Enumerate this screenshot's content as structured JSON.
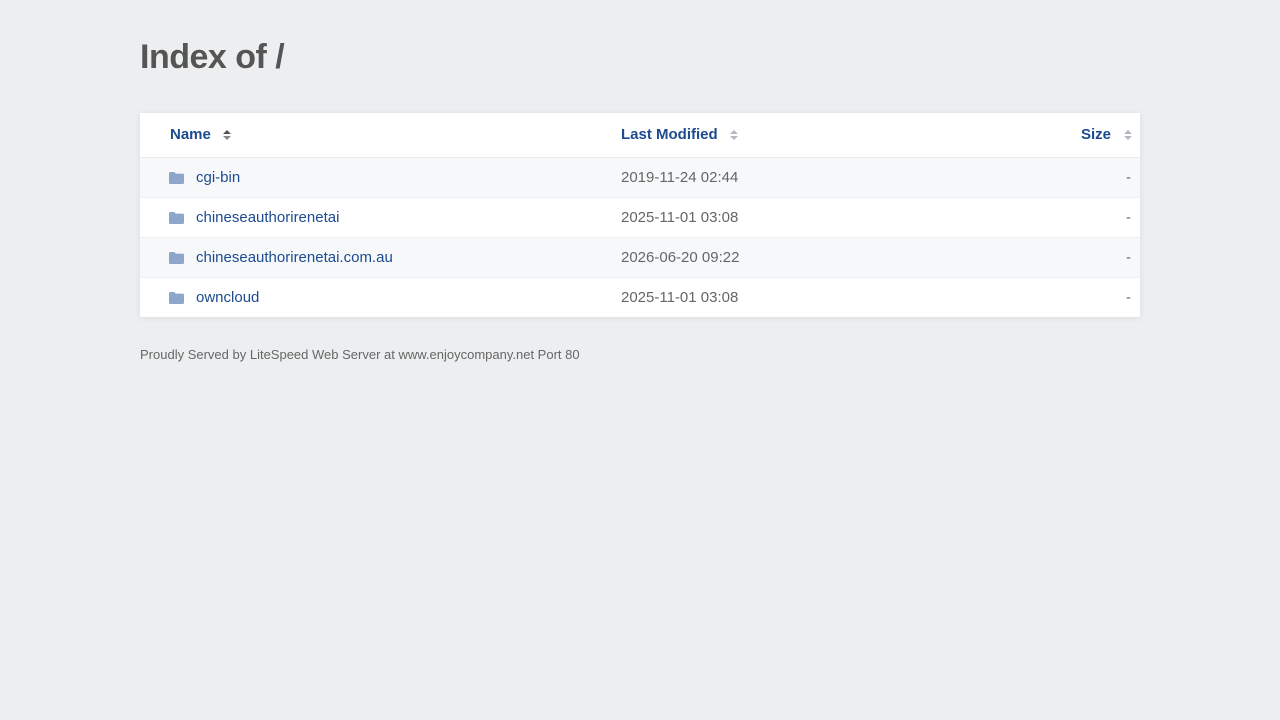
{
  "page": {
    "title": "Index of /"
  },
  "table": {
    "headers": {
      "name": "Name",
      "modified": "Last Modified",
      "size": "Size"
    },
    "rows": [
      {
        "name": "cgi-bin",
        "modified": "2019-11-24 02:44",
        "size": "-",
        "icon": "folder-icon"
      },
      {
        "name": "chineseauthorirenetai",
        "modified": "2025-11-01 03:08",
        "size": "-",
        "icon": "folder-icon"
      },
      {
        "name": "chineseauthorirenetai.com.au",
        "modified": "2026-06-20 09:22",
        "size": "-",
        "icon": "folder-icon"
      },
      {
        "name": "owncloud",
        "modified": "2025-11-01 03:08",
        "size": "-",
        "icon": "folder-icon"
      }
    ]
  },
  "footer": {
    "text": "Proudly Served by LiteSpeed Web Server at www.enjoycompany.net Port 80"
  },
  "colors": {
    "background": "#eceef0",
    "link": "#1d4b8f",
    "folder": "#8ea6c9"
  }
}
